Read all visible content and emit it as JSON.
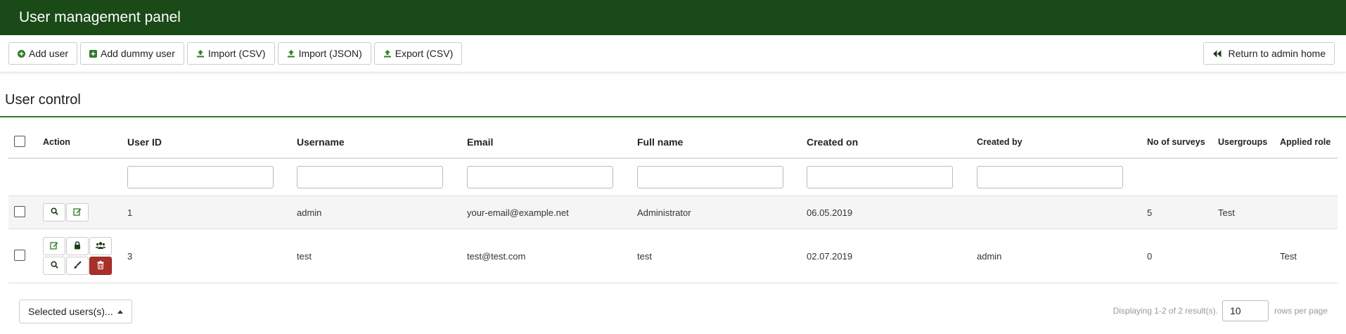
{
  "header": {
    "title": "User management panel"
  },
  "toolbar": {
    "add_user": "Add user",
    "add_dummy": "Add dummy user",
    "import_csv": "Import (CSV)",
    "import_json": "Import (JSON)",
    "export_csv": "Export (CSV)",
    "return_home": "Return to admin home"
  },
  "section": {
    "title": "User control"
  },
  "table": {
    "headers": {
      "action": "Action",
      "user_id": "User ID",
      "username": "Username",
      "email": "Email",
      "full_name": "Full name",
      "created_on": "Created on",
      "created_by": "Created by",
      "no_surveys": "No of surveys",
      "usergroups": "Usergroups",
      "applied_role": "Applied role"
    },
    "rows": [
      {
        "user_id": "1",
        "username": "admin",
        "email": "your-email@example.net",
        "full_name": "Administrator",
        "created_on": "06.05.2019",
        "created_by": "",
        "no_surveys": "5",
        "usergroups": "Test",
        "applied_role": ""
      },
      {
        "user_id": "3",
        "username": "test",
        "email": "test@test.com",
        "full_name": "test",
        "created_on": "02.07.2019",
        "created_by": "admin",
        "no_surveys": "0",
        "usergroups": "",
        "applied_role": "Test"
      }
    ]
  },
  "footer": {
    "selected_users": "Selected users(s)...",
    "displaying": "Displaying 1-2 of 2 result(s).",
    "page_size": "10",
    "rows_per_page": "rows per page"
  },
  "colors": {
    "header_bg": "#1a4a17",
    "accent": "#2f7a2a",
    "danger": "#a9302a"
  }
}
